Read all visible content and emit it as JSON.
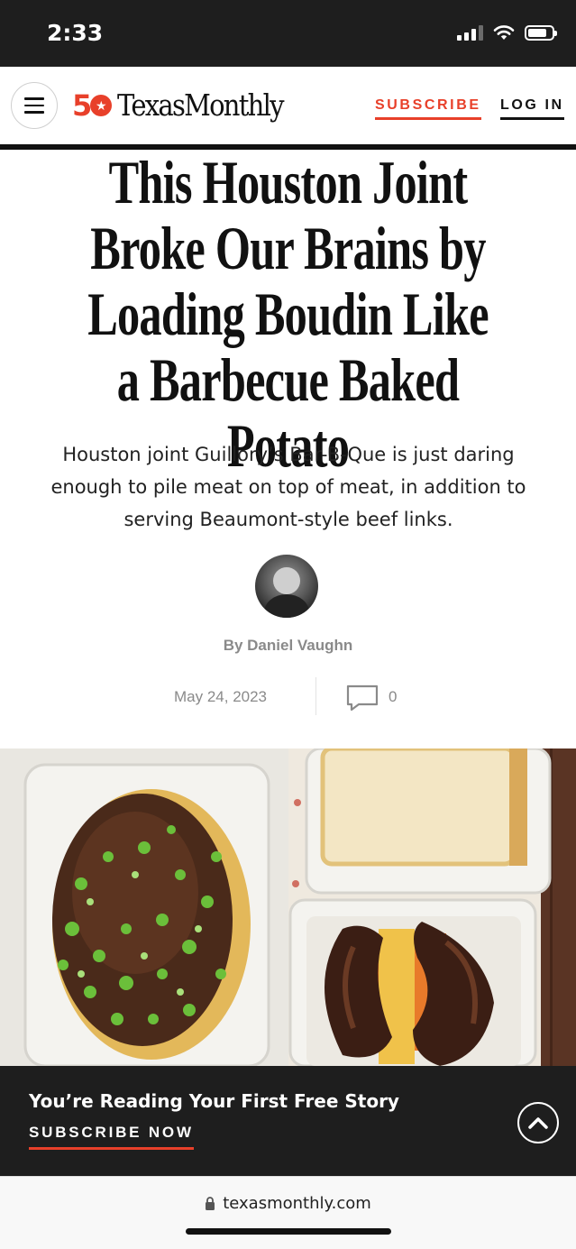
{
  "status_bar": {
    "time": "2:33"
  },
  "header": {
    "logo_number": "50",
    "logo_text": "TexasMonthly",
    "subscribe_label": "SUBSCRIBE",
    "login_label": "LOG IN"
  },
  "article": {
    "headline": "This Houston Joint Broke Our Brains by Loading Boudin Like a Barbecue Baked Potato",
    "dek": "Houston joint Guillory’s Bar-B-Que is just daring enough to pile meat on top of meat, in addition to serving Beaumont-style beef links.",
    "byline": "By Daniel Vaughn",
    "date": "May 24, 2023",
    "comment_count": "0"
  },
  "paywall": {
    "title": "You’re Reading Your First Free Story",
    "cta": "SUBSCRIBE NOW"
  },
  "browser": {
    "url": "texasmonthly.com"
  },
  "colors": {
    "brand_red": "#e8402a",
    "dark": "#1e1e1e"
  },
  "icons": [
    "menu-icon",
    "comment-icon",
    "chevron-up-icon",
    "lock-icon",
    "wifi-icon",
    "battery-icon",
    "signal-icon"
  ]
}
